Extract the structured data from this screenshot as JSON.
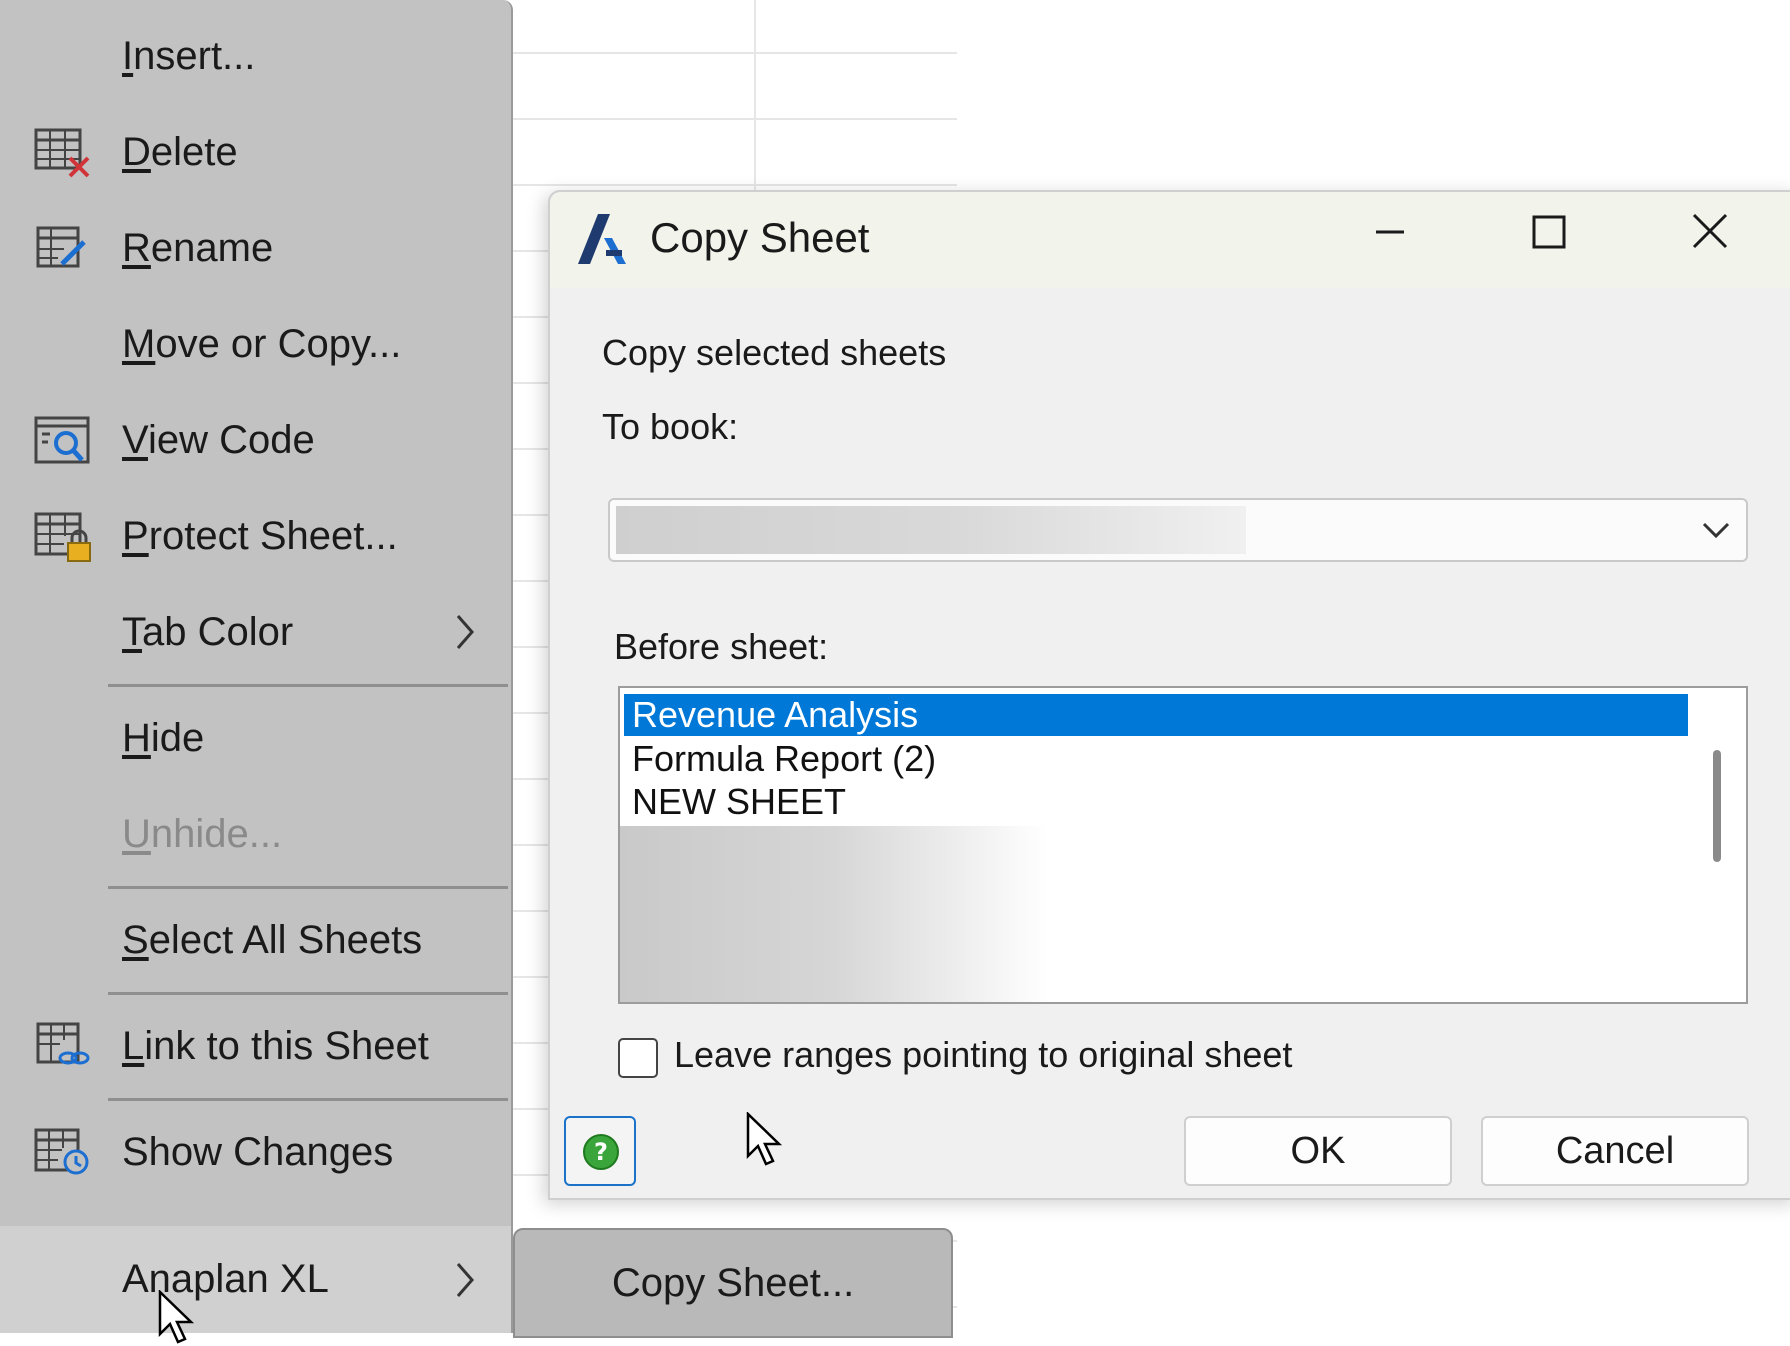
{
  "context_menu": {
    "items": [
      {
        "label": "Insert...",
        "ul": "I",
        "rest": "nsert...",
        "icon": "none"
      },
      {
        "label": "Delete",
        "ul": "D",
        "rest": "elete",
        "icon": "delete-sheet-icon"
      },
      {
        "label": "Rename",
        "ul": "R",
        "rest": "ename",
        "icon": "rename-sheet-icon"
      },
      {
        "label": "Move or Copy...",
        "ul": "M",
        "rest": "ove or Copy...",
        "icon": "none"
      },
      {
        "label": "View Code",
        "ul": "V",
        "rest": "iew Code",
        "icon": "view-code-icon"
      },
      {
        "label": "Protect Sheet...",
        "ul": "P",
        "rest": "rotect Sheet...",
        "icon": "protect-sheet-icon"
      },
      {
        "label": "Tab Color",
        "ul": "T",
        "rest": "ab Color",
        "icon": "none",
        "submenu": true
      },
      {
        "label": "Hide",
        "ul": "H",
        "rest": "ide",
        "icon": "none"
      },
      {
        "label": "Unhide...",
        "ul": "U",
        "rest": "nhide...",
        "icon": "none",
        "disabled": true
      },
      {
        "label": "Select All Sheets",
        "ul": "S",
        "rest": "elect All Sheets",
        "icon": "none"
      },
      {
        "label": "Link to this Sheet",
        "ul": "L",
        "rest": "ink to this Sheet",
        "icon": "link-sheet-icon"
      },
      {
        "label": "Show Changes",
        "ul": "",
        "rest": "Show Changes",
        "icon": "show-changes-icon"
      },
      {
        "label": "Anaplan XL",
        "ul": "",
        "rest": "Anaplan XL",
        "icon": "none",
        "submenu": true
      }
    ]
  },
  "submenu": {
    "items": [
      {
        "label": "Copy Sheet..."
      }
    ]
  },
  "dialog": {
    "title": "Copy Sheet",
    "heading": "Copy selected sheets",
    "to_book_label": "To book:",
    "before_sheet_label": "Before sheet:",
    "sheets": [
      "Revenue Analysis",
      "Formula Report (2)",
      "NEW SHEET"
    ],
    "selected_sheet": "Revenue Analysis",
    "checkbox_label": "Leave ranges pointing to original sheet",
    "checkbox_checked": false,
    "ok_label": "OK",
    "cancel_label": "Cancel"
  },
  "colors": {
    "selection": "#0078d7",
    "menu_bg": "#c2c2c2",
    "logo_dark": "#1e3a6e",
    "logo_blue": "#1c6fd1"
  }
}
